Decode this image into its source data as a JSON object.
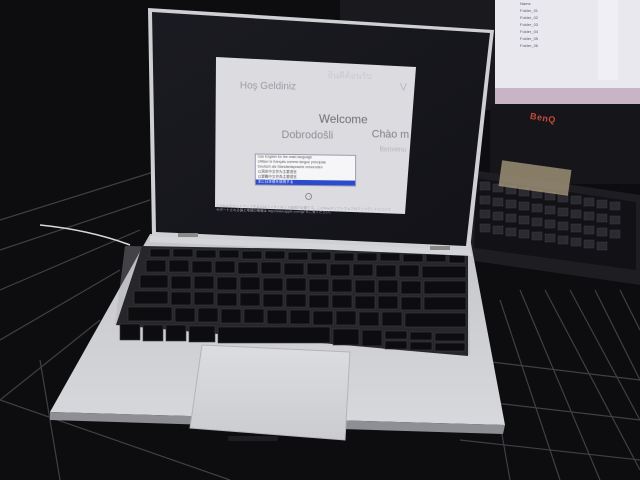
{
  "setup": {
    "greetings": {
      "hos": "Hoş Geldiniz",
      "sawasdee": "ยินดีต้อนรับ",
      "v": "V",
      "welcome": "Welcome",
      "dobrodosli": "Dobrodošli",
      "chao": "Chào m",
      "benvenuto": "Benvenu"
    },
    "languages": [
      "Use English for the main language",
      "Utiliser le français comme langue principale",
      "Deutsch als Standardsprache verwenden",
      "以简体中文作为主要语言",
      "以繁體中文作為主要語言",
      "主に日本語を使用する"
    ],
    "selected_language_index": 5,
    "continue_glyph": "→",
    "notice_lines": [
      "このMacをセットアップするにはインターネット接続が必要です。このMacのソフトウェアのアップデートについて",
      "サポートされる国と地域の情報は http://www.apple.com/jp/ をご覧ください。"
    ]
  },
  "monitor": {
    "brand": "BenQ",
    "screen_lines": [
      "Name",
      "Folder_01",
      "Folder_02",
      "Folder_03",
      "Folder_04",
      "Folder_05",
      "Folder_06"
    ]
  },
  "colors": {
    "selection": "#2a4bd0",
    "screen_bg": "#dcdce0",
    "aluminum": "#c9cacf",
    "monitor_accent": "#c44a3a",
    "taskbar": "#c8b4c4"
  }
}
